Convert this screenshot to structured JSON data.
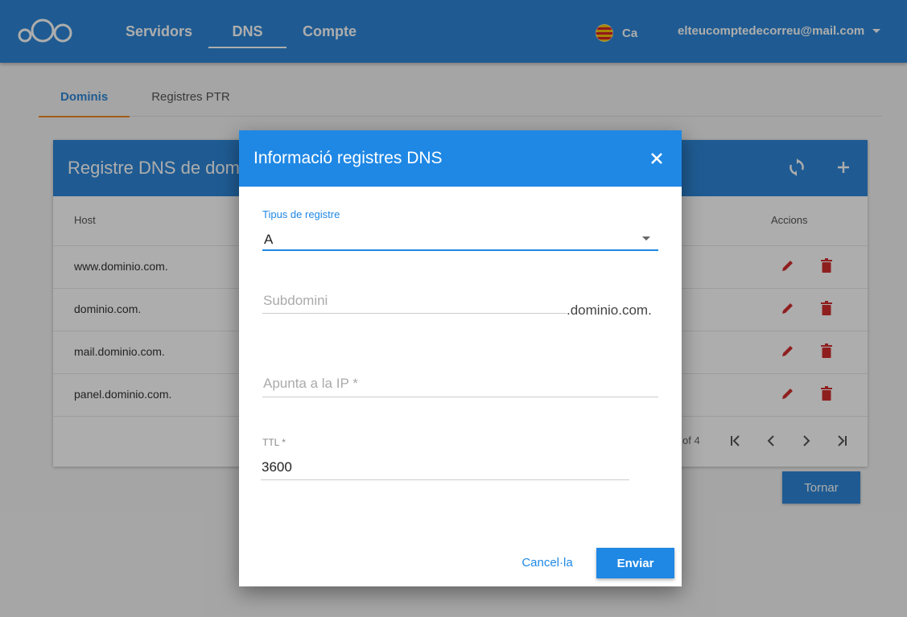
{
  "header": {
    "logo_icon": "owncloud-logo-icon",
    "nav": [
      {
        "label": "Servidors",
        "active": false
      },
      {
        "label": "DNS",
        "active": true
      },
      {
        "label": "Compte",
        "active": false
      }
    ],
    "language": "Ca",
    "account_email": "elteucomptedecorreu@mail.com"
  },
  "tabs": [
    {
      "label": "Dominis",
      "active": true
    },
    {
      "label": "Registres PTR",
      "active": false
    }
  ],
  "card": {
    "title": "Registre DNS de dom",
    "columns": {
      "host": "Host",
      "actions": "Accions"
    },
    "rows": [
      {
        "host": "www.dominio.com."
      },
      {
        "host": "dominio.com."
      },
      {
        "host": "mail.dominio.com."
      },
      {
        "host": "panel.dominio.com."
      }
    ],
    "pagination_text": "of 4"
  },
  "back_button": "Tornar",
  "dialog": {
    "title": "Informació registres DNS",
    "record_type_label": "Tipus de registre",
    "record_type_value": "A",
    "subdomain_placeholder": "Subdomini",
    "subdomain_suffix": ".dominio.com.",
    "ip_placeholder": "Apunta a la IP *",
    "ttl_label": "TTL *",
    "ttl_value": "3600",
    "cancel_label": "Cancel·la",
    "submit_label": "Enviar"
  },
  "colors": {
    "primary": "#2f86d7",
    "dialog_primary": "#1f88e5",
    "tab_indicator": "#f08a24",
    "danger": "#d32f2f"
  }
}
